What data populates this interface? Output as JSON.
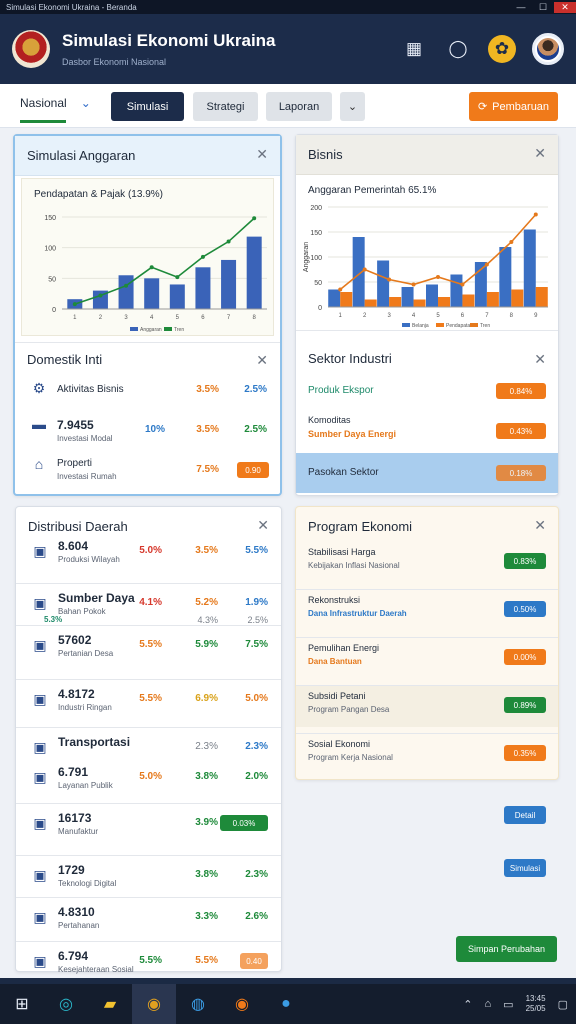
{
  "window": {
    "title": "Simulasi Ekonomi Ukraina - Beranda"
  },
  "header": {
    "title": "Simulasi Ekonomi Ukraina",
    "subtitle": "Dasbor Ekonomi Nasional",
    "icons": [
      "calculator-icon",
      "globe-icon",
      "sunflower-icon",
      "avatar"
    ]
  },
  "toolbar": {
    "select_label": "Nasional",
    "buttons": [
      "Simulasi",
      "Strategi",
      "Laporan"
    ],
    "action_label": "Pembaruan"
  },
  "cards": {
    "simulation": {
      "title": "Simulasi Anggaran"
    },
    "business": {
      "title": "Bisnis"
    },
    "domestic": {
      "title": "Domestik Inti"
    },
    "regional": {
      "title": "Sektor Industri"
    },
    "distribution": {
      "title": "Distribusi Daerah"
    },
    "program": {
      "title": "Program Ekonomi"
    }
  },
  "chart_data": [
    {
      "type": "bar",
      "title": "Pendapatan & Pajak (13.9%)",
      "categories": [
        "1",
        "2",
        "3",
        "4",
        "5",
        "6",
        "7",
        "8"
      ],
      "series": [
        {
          "name": "Anggaran",
          "values": [
            16,
            30,
            55,
            50,
            40,
            68,
            80,
            118
          ]
        },
        {
          "name": "Tren",
          "values": [
            8,
            22,
            38,
            68,
            52,
            85,
            110,
            148
          ]
        }
      ],
      "ylim": [
        0,
        150
      ],
      "yticks": [
        0,
        50,
        100,
        150
      ],
      "xlabel": "",
      "ylabel": ""
    },
    {
      "type": "bar",
      "title": "Anggaran Pemerintah 65.1%",
      "categories": [
        "1",
        "2",
        "3",
        "4",
        "5",
        "6",
        "7",
        "8",
        "9"
      ],
      "series": [
        {
          "name": "Belanja",
          "values": [
            35,
            140,
            93,
            40,
            45,
            65,
            90,
            120,
            155
          ]
        },
        {
          "name": "Pendapatan",
          "values": [
            30,
            15,
            20,
            15,
            20,
            25,
            30,
            35,
            40
          ]
        },
        {
          "name": "Tren",
          "values": [
            35,
            75,
            55,
            45,
            60,
            45,
            85,
            130,
            185
          ]
        }
      ],
      "ylim": [
        0,
        200
      ],
      "yticks": [
        0,
        50,
        100,
        150,
        200
      ],
      "xlabel": "",
      "ylabel": "Anggaran"
    }
  ],
  "domestic_rows": [
    {
      "icon": "gear-icon",
      "label": "Aktivitas Bisnis",
      "big": false,
      "v1": "3.5%",
      "v2": "2.5%"
    },
    {
      "icon": "wallet-icon",
      "label": "7.9455",
      "sub": "Investasi Modal",
      "big": true,
      "v0": "10%",
      "v1": "3.5%",
      "v2": "2.5%"
    },
    {
      "icon": "house-icon",
      "label": "Properti",
      "sub": "Investasi Rumah",
      "big": false,
      "v1": "7.5%",
      "pill": "0.90"
    }
  ],
  "sector_rows": [
    {
      "label": "Produk Ekspor",
      "pill": "0.84%"
    },
    {
      "label": "Komoditas",
      "sub": "Sumber Daya Energi",
      "pill": "0.43%"
    },
    {
      "label": "Pasokan Sektor",
      "pill": "0.18%"
    }
  ],
  "distribution_rows": [
    {
      "icon": "chart-icon",
      "label": "8.604",
      "sub": "Produksi Wilayah",
      "v1": "5.0%",
      "v2": "3.5%",
      "v3": "5.5%"
    },
    {
      "icon": "pill-icon",
      "label": "Sumber Daya",
      "sub": "Bahan Pokok",
      "v1": "4.1%",
      "v2": "5.2%",
      "v3": "1.9%",
      "v4": "5.3%",
      "v5": "4.3%",
      "v6": "2.5%"
    },
    {
      "icon": "calculator-icon",
      "label": "57602",
      "sub": "Pertanian Desa",
      "v1": "5.5%",
      "v2": "5.9%",
      "v3": "7.5%"
    },
    {
      "icon": "clipboard-icon",
      "label": "4.8172",
      "sub": "Industri Ringan",
      "v1": "5.5%",
      "v2": "6.9%",
      "v3": "5.0%"
    },
    {
      "icon": "car-icon",
      "label": "Transportasi",
      "v1": "2.3%",
      "v2": "2.3%"
    },
    {
      "icon": "calendar-icon",
      "label": "6.791",
      "sub": "Layanan Publik",
      "v1": "5.0%",
      "v2": "3.8%",
      "v3": "2.0%"
    },
    {
      "icon": "tool-icon",
      "label": "16173",
      "sub": "Manufaktur",
      "v1": "3.9%",
      "pill": "0.03%"
    },
    {
      "icon": "grid-icon",
      "label": "1729",
      "sub": "Teknologi Digital",
      "v1": "3.8%",
      "v2": "2.3%"
    },
    {
      "icon": "shield-icon",
      "label": "4.8310",
      "sub": "Pertahanan",
      "v1": "3.3%",
      "v2": "2.6%"
    },
    {
      "icon": "flag-icon",
      "label": "6.794",
      "sub": "Kesejahteraan Sosial",
      "v1": "5.5%",
      "v2": "5.5%",
      "pill": "0.40"
    }
  ],
  "program_rows": [
    {
      "label": "Stabilisasi Harga",
      "sub": "Kebijakan Inflasi Nasional",
      "pill": "0.83%",
      "color": "green"
    },
    {
      "label": "Rekonstruksi",
      "sub": "Dana Infrastruktur Daerah",
      "pill": "0.50%",
      "color": "blue"
    },
    {
      "label": "Pemulihan Energi",
      "sub": "Dana Bantuan",
      "pill": "0.00%",
      "color": "orange"
    },
    {
      "label": "Subsidi Petani",
      "sub": "Program Pangan Desa",
      "pill": "0.89%",
      "color": "green"
    },
    {
      "label": "Sosial Ekonomi",
      "sub": "Program Kerja Nasional",
      "pill": "0.35%",
      "color": "orange"
    }
  ],
  "side_pills": [
    "Detail",
    "Simulasi"
  ],
  "footer_button": "Simpan Perubahan",
  "taskbar": {
    "time": "13:45",
    "date": "25/05"
  }
}
